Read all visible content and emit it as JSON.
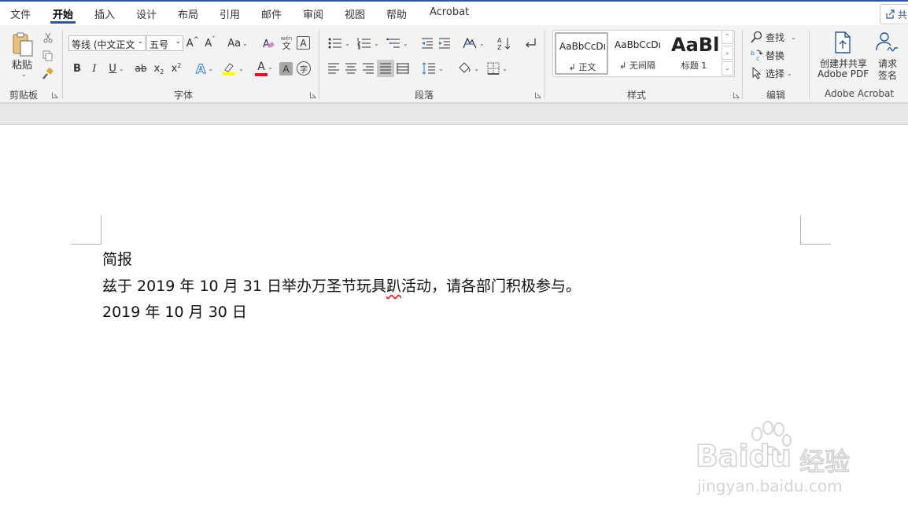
{
  "menu": {
    "tabs": [
      "文件",
      "开始",
      "插入",
      "设计",
      "布局",
      "引用",
      "邮件",
      "审阅",
      "视图",
      "帮助",
      "Acrobat"
    ],
    "active_tab": "开始",
    "share_label": "共"
  },
  "ribbon": {
    "clipboard": {
      "paste_label": "粘贴",
      "group_label": "剪贴板"
    },
    "font": {
      "font_name": "等线 (中文正文",
      "font_size": "五号",
      "grow_label": "A",
      "shrink_label": "A",
      "case_label": "Aa",
      "phonetic_top": "wén",
      "phonetic_bottom": "文",
      "border_char_label": "A",
      "bold": "B",
      "italic": "I",
      "underline": "U",
      "strike": "ab",
      "subscript": "x",
      "superscript": "x",
      "text_effect": "A",
      "font_color": "A",
      "char_shading": "A",
      "enclose_char": "字",
      "group_label": "字体",
      "highlight_color": "#ffff00",
      "font_color_value": "#e81123"
    },
    "paragraph": {
      "group_label": "段落"
    },
    "styles": {
      "items": [
        {
          "preview": "AaBbCcDı",
          "name": "↲ 正文"
        },
        {
          "preview": "AaBbCcDı",
          "name": "↲ 无间隔"
        },
        {
          "preview": "AaBl",
          "name": "标题 1"
        }
      ],
      "group_label": "样式"
    },
    "editing": {
      "find_label": "查找",
      "replace_label": "替换",
      "select_label": "选择",
      "group_label": "编辑"
    },
    "acrobat": {
      "create_pdf_line1": "创建并共享",
      "create_pdf_line2": "Adobe PDF",
      "sign_line1": "请求",
      "sign_line2": "签名",
      "group_label": "Adobe Acrobat"
    }
  },
  "document": {
    "line1": "简报",
    "line2_before": "兹于 2019 年 10 月 31 日举办万圣节玩具",
    "line2_flagged": "趴",
    "line2_after": "活动，请各部门积极参与。",
    "line3": "2019 年 10 月 30 日"
  },
  "watermark": {
    "brand": "Baidu",
    "brand_cn": "经验",
    "url": "jingyan.baidu.com"
  },
  "colors": {
    "accent": "#2b579a",
    "ribbon_bg": "#f3f3f3",
    "spell_error": "#d33"
  }
}
